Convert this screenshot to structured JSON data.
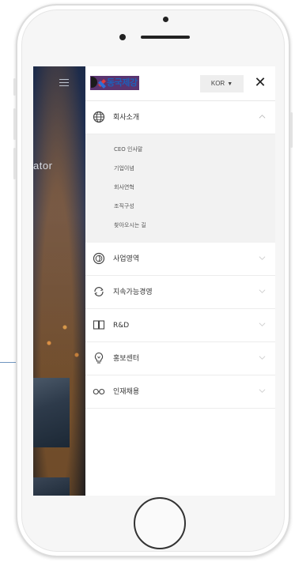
{
  "background_page": {
    "hero_text": "ator"
  },
  "menu": {
    "logo_text": "동국제강",
    "language": "KOR",
    "items": [
      {
        "label": "회사소개",
        "icon": "globe-icon",
        "expanded": true,
        "subitems": [
          "CEO 인사말",
          "기업이념",
          "회사연혁",
          "조직구성",
          "찾아오시는 길"
        ]
      },
      {
        "label": "사업영역",
        "icon": "business-area-icon",
        "expanded": false
      },
      {
        "label": "지속가능경영",
        "icon": "cycle-icon",
        "expanded": false
      },
      {
        "label": "R&D",
        "icon": "book-icon",
        "expanded": false
      },
      {
        "label": "홍보센터",
        "icon": "lightbulb-icon",
        "expanded": false
      },
      {
        "label": "인재채용",
        "icon": "glasses-icon",
        "expanded": false
      }
    ]
  },
  "colors": {
    "logo_bg": "#5a3470",
    "logo_text": "#1e5fb8",
    "submenu_bg": "#f2f2f2",
    "accent_line": "#6f95bf"
  }
}
